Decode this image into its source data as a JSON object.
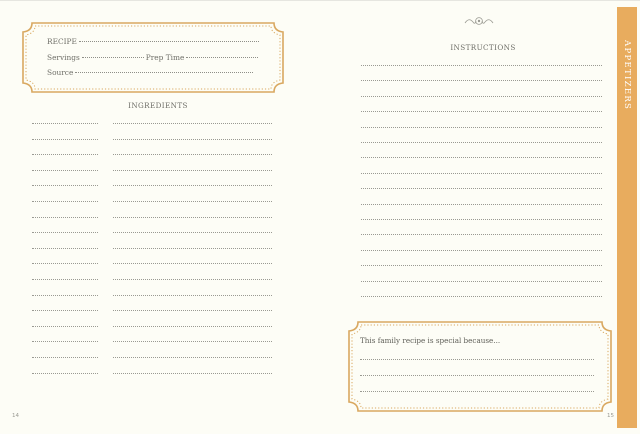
{
  "recipe_card": {
    "recipe_label": "RECIPE",
    "servings_label": "Servings",
    "prep_time_label": "Prep Time",
    "source_label": "Source"
  },
  "ingredients": {
    "title": "INGREDIENTS",
    "line_count": 17
  },
  "instructions": {
    "title": "INSTRUCTIONS",
    "line_count": 16
  },
  "special_box": {
    "prompt": "This family recipe is special because...",
    "line_count": 3
  },
  "tab": {
    "label": "APPETIZERS",
    "color": "#e8ac5e"
  },
  "pages": {
    "left": "14",
    "right": "15"
  },
  "colors": {
    "accent": "#d9a860",
    "background": "#fdfdf6"
  }
}
